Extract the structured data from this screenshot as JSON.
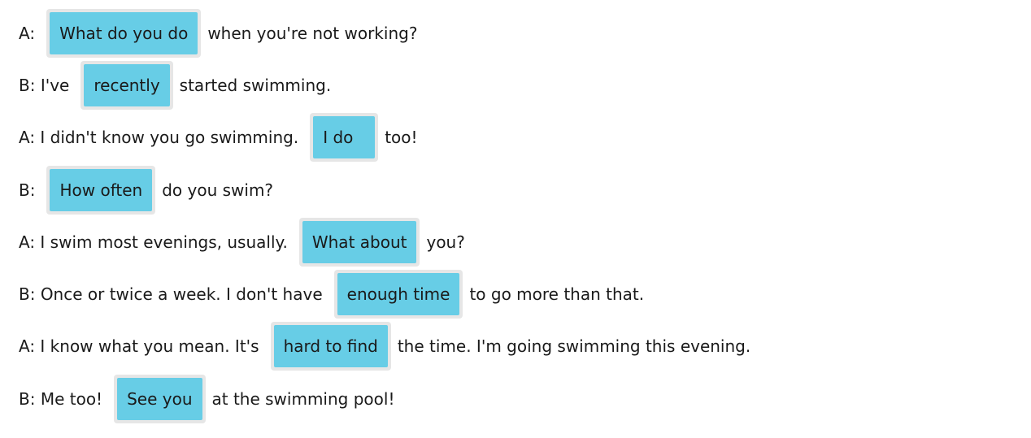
{
  "lines": [
    {
      "prefix": "A:",
      "answer": "What do you do",
      "suffix": "when you're not working?"
    },
    {
      "prefix": "B: I've",
      "answer": "recently",
      "suffix": "started swimming."
    },
    {
      "prefix": "A: I didn't know you go swimming.",
      "answer": "I do",
      "suffix": "too!"
    },
    {
      "prefix": "B:",
      "answer": "How often",
      "suffix": "do you swim?"
    },
    {
      "prefix": "A: I swim most evenings, usually.",
      "answer": "What about",
      "suffix": "you?"
    },
    {
      "prefix": "B: Once or twice a week. I don't have",
      "answer": "enough time",
      "suffix": "to go more than that."
    },
    {
      "prefix": "A: I know what you mean. It's",
      "answer": "hard to find",
      "suffix": "the time. I'm going swimming this evening."
    },
    {
      "prefix": "B: Me too!",
      "answer": "See you",
      "suffix": "at the swimming pool!"
    }
  ],
  "colors": {
    "chip": "#67cde6",
    "slot": "#e6e6e6",
    "text": "#1a1a1a"
  }
}
